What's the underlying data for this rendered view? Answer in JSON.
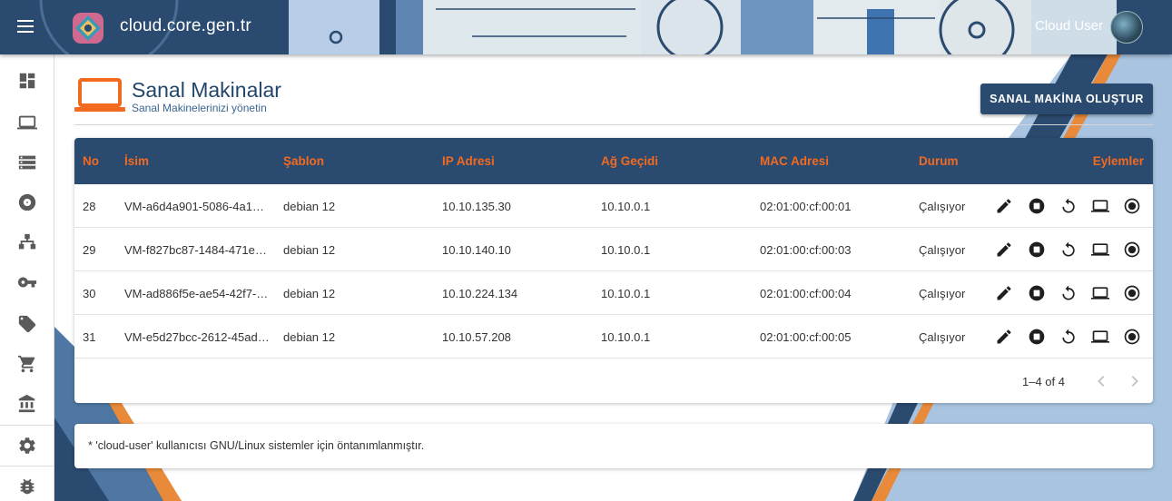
{
  "header": {
    "brand": "cloud.core.gen.tr",
    "user": "Cloud User",
    "menu_icon": "menu-icon",
    "avatar_icon": "avatar"
  },
  "sidebar": {
    "items": [
      {
        "name": "dashboard",
        "icon": "dashboard-icon"
      },
      {
        "name": "virtual-machines",
        "icon": "laptop-icon"
      },
      {
        "name": "storage",
        "icon": "storage-icon"
      },
      {
        "name": "disks",
        "icon": "disc-icon"
      },
      {
        "name": "networks",
        "icon": "network-icon"
      },
      {
        "name": "keys",
        "icon": "key-icon"
      },
      {
        "name": "tags",
        "icon": "tag-icon"
      },
      {
        "name": "shop",
        "icon": "cart-icon"
      },
      {
        "name": "billing",
        "icon": "bank-icon"
      },
      {
        "name": "settings",
        "icon": "gear-icon"
      },
      {
        "name": "debug",
        "icon": "bug-icon"
      }
    ]
  },
  "page": {
    "title": "Sanal Makinalar",
    "subtitle": "Sanal Makinelerinizi yönetin",
    "create_button": "SANAL MAKİNA OLUŞTUR"
  },
  "table": {
    "columns": [
      "No",
      "İsim",
      "Şablon",
      "IP Adresi",
      "Ağ Geçidi",
      "MAC Adresi",
      "Durum",
      "Eylemler"
    ],
    "rows": [
      {
        "no": "28",
        "name": "VM-a6d4a901-5086-4a1…",
        "template": "debian 12",
        "ip": "10.10.135.30",
        "gateway": "10.10.0.1",
        "mac": "02:01:00:cf:00:01",
        "status": "Çalışıyor"
      },
      {
        "no": "29",
        "name": "VM-f827bc87-1484-471e…",
        "template": "debian 12",
        "ip": "10.10.140.10",
        "gateway": "10.10.0.1",
        "mac": "02:01:00:cf:00:03",
        "status": "Çalışıyor"
      },
      {
        "no": "30",
        "name": "VM-ad886f5e-ae54-42f7-…",
        "template": "debian 12",
        "ip": "10.10.224.134",
        "gateway": "10.10.0.1",
        "mac": "02:01:00:cf:00:04",
        "status": "Çalışıyor"
      },
      {
        "no": "31",
        "name": "VM-e5d27bcc-2612-45ad…",
        "template": "debian 12",
        "ip": "10.10.57.208",
        "gateway": "10.10.0.1",
        "mac": "02:01:00:cf:00:05",
        "status": "Çalışıyor"
      }
    ],
    "actions": [
      "edit-icon",
      "stop-icon",
      "restart-icon",
      "console-icon",
      "snapshot-icon"
    ],
    "pagination": "1–4 of 4"
  },
  "note": {
    "text": "* 'cloud-user' kullanıcısı GNU/Linux sistemler için öntanımlanmıştır."
  },
  "colors": {
    "primary": "#2b4a6f",
    "accent": "#f26a1f"
  }
}
